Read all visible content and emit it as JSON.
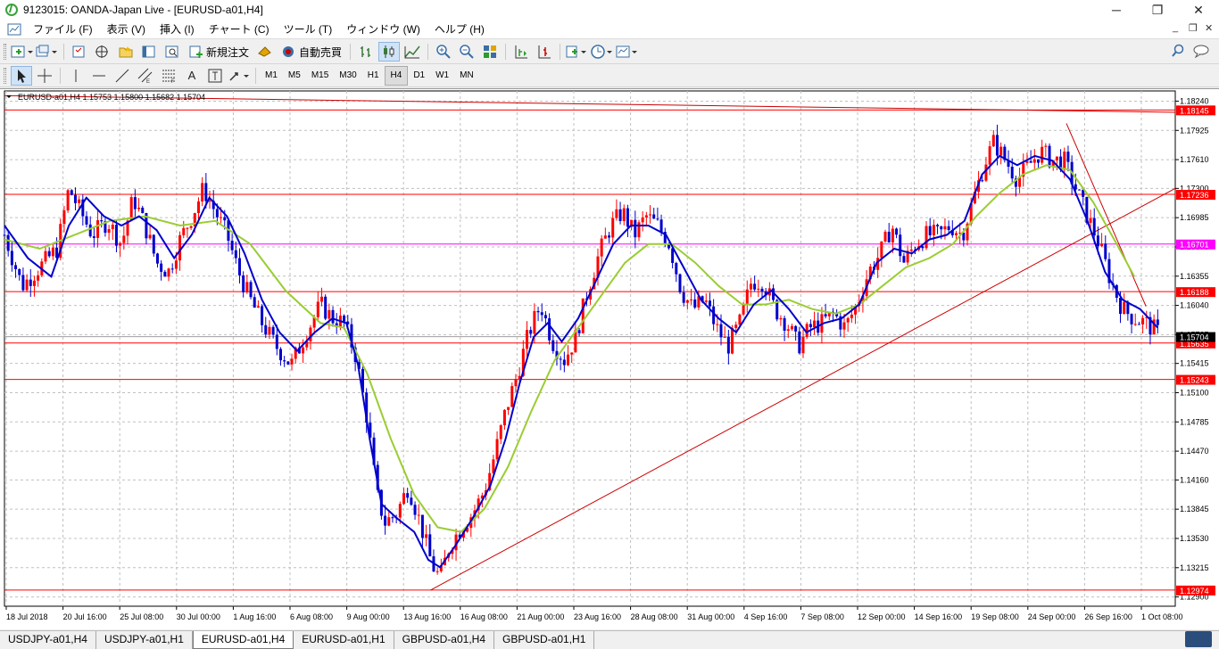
{
  "window": {
    "title": "9123015: OANDA-Japan Live - [EURUSD-a01,H4]",
    "controls": {
      "minimize": "─",
      "maximize": "❐",
      "close": "✕"
    }
  },
  "menu": {
    "items": [
      "ファイル (F)",
      "表示 (V)",
      "挿入 (I)",
      "チャート (C)",
      "ツール (T)",
      "ウィンドウ (W)",
      "ヘルプ (H)"
    ],
    "mdi_controls": {
      "minimize": "_",
      "restore": "❐",
      "close": "✕"
    }
  },
  "toolbar": {
    "new_order_label": "新規注文",
    "autotrade_label": "自動売買",
    "timeframes": [
      "M1",
      "M5",
      "M15",
      "M30",
      "H1",
      "H4",
      "D1",
      "W1",
      "MN"
    ],
    "active_timeframe": "H4",
    "text_tool_label": "A"
  },
  "chart_data": {
    "type": "candlestick",
    "header": "EURUSD-a01,H4  1.15753 1.15800 1.15682 1.15704",
    "ylim": [
      1.128,
      1.1835
    ],
    "price_ticks": [
      "1.18240",
      "1.17925",
      "1.17610",
      "1.17300",
      "1.16985",
      "1.16670",
      "1.16355",
      "1.16040",
      "1.15725",
      "1.15415",
      "1.15100",
      "1.14785",
      "1.14470",
      "1.14160",
      "1.13845",
      "1.13530",
      "1.13215",
      "1.12900"
    ],
    "time_labels": [
      "18 Jul 2018",
      "20 Jul 16:00",
      "25 Jul 08:00",
      "30 Jul 00:00",
      "1 Aug 16:00",
      "6 Aug 08:00",
      "9 Aug 00:00",
      "13 Aug 16:00",
      "16 Aug 08:00",
      "21 Aug 00:00",
      "23 Aug 16:00",
      "28 Aug 08:00",
      "31 Aug 00:00",
      "4 Sep 16:00",
      "7 Sep 08:00",
      "12 Sep 00:00",
      "14 Sep 16:00",
      "19 Sep 08:00",
      "24 Sep 00:00",
      "26 Sep 16:00",
      "1 Oct 08:00"
    ],
    "horizontal_levels": [
      {
        "label": "1.18145",
        "price": 1.18145,
        "color": "#ff0000"
      },
      {
        "label": "1.17236",
        "price": 1.17236,
        "color": "#ff0000"
      },
      {
        "label": "1.16701",
        "price": 1.16701,
        "color": "#ff00ff"
      },
      {
        "label": "1.16188",
        "price": 1.16188,
        "color": "#ff0000"
      },
      {
        "label": "1.15635",
        "price": 1.15635,
        "color": "#ff0000"
      },
      {
        "label": "1.15243",
        "price": 1.15243,
        "color": "#ff0000"
      },
      {
        "label": "1.12974",
        "price": 1.12974,
        "color": "#ff0000"
      }
    ],
    "current_price": {
      "label": "1.15704",
      "price": 1.15704
    },
    "trendlines": [
      {
        "from": [
          0.0,
          1.183
        ],
        "to": [
          1.0,
          1.1812
        ]
      },
      {
        "from": [
          0.364,
          1.12974
        ],
        "to": [
          1.0,
          1.173
        ]
      },
      {
        "from": [
          0.907,
          1.18
        ],
        "to": [
          0.975,
          1.1603
        ]
      }
    ],
    "close_path": [
      [
        0.0,
        1.168
      ],
      [
        0.015,
        1.1625
      ],
      [
        0.03,
        1.1645
      ],
      [
        0.045,
        1.1665
      ],
      [
        0.055,
        1.173
      ],
      [
        0.065,
        1.1705
      ],
      [
        0.075,
        1.168
      ],
      [
        0.088,
        1.1695
      ],
      [
        0.1,
        1.167
      ],
      [
        0.11,
        1.172
      ],
      [
        0.12,
        1.169
      ],
      [
        0.13,
        1.165
      ],
      [
        0.14,
        1.164
      ],
      [
        0.15,
        1.1675
      ],
      [
        0.16,
        1.17
      ],
      [
        0.17,
        1.173
      ],
      [
        0.18,
        1.1705
      ],
      [
        0.19,
        1.168
      ],
      [
        0.2,
        1.164
      ],
      [
        0.21,
        1.161
      ],
      [
        0.22,
        1.1585
      ],
      [
        0.232,
        1.156
      ],
      [
        0.245,
        1.154
      ],
      [
        0.258,
        1.1575
      ],
      [
        0.27,
        1.1605
      ],
      [
        0.28,
        1.159
      ],
      [
        0.29,
        1.1585
      ],
      [
        0.3,
        1.155
      ],
      [
        0.31,
        1.148
      ],
      [
        0.318,
        1.14
      ],
      [
        0.325,
        1.137
      ],
      [
        0.335,
        1.138
      ],
      [
        0.345,
        1.141
      ],
      [
        0.355,
        1.137
      ],
      [
        0.365,
        1.1325
      ],
      [
        0.372,
        1.131
      ],
      [
        0.38,
        1.1345
      ],
      [
        0.39,
        1.1365
      ],
      [
        0.4,
        1.138
      ],
      [
        0.41,
        1.1405
      ],
      [
        0.418,
        1.144
      ],
      [
        0.428,
        1.149
      ],
      [
        0.438,
        1.153
      ],
      [
        0.448,
        1.1575
      ],
      [
        0.458,
        1.1605
      ],
      [
        0.468,
        1.1565
      ],
      [
        0.478,
        1.1545
      ],
      [
        0.488,
        1.157
      ],
      [
        0.498,
        1.162
      ],
      [
        0.508,
        1.166
      ],
      [
        0.518,
        1.169
      ],
      [
        0.528,
        1.1705
      ],
      [
        0.538,
        1.168
      ],
      [
        0.548,
        1.17
      ],
      [
        0.558,
        1.169
      ],
      [
        0.568,
        1.167
      ],
      [
        0.578,
        1.162
      ],
      [
        0.588,
        1.16
      ],
      [
        0.598,
        1.161
      ],
      [
        0.608,
        1.158
      ],
      [
        0.618,
        1.156
      ],
      [
        0.628,
        1.1585
      ],
      [
        0.638,
        1.163
      ],
      [
        0.648,
        1.163
      ],
      [
        0.658,
        1.16
      ],
      [
        0.668,
        1.1585
      ],
      [
        0.678,
        1.156
      ],
      [
        0.688,
        1.158
      ],
      [
        0.698,
        1.1585
      ],
      [
        0.708,
        1.1595
      ],
      [
        0.718,
        1.158
      ],
      [
        0.728,
        1.1605
      ],
      [
        0.738,
        1.164
      ],
      [
        0.748,
        1.166
      ],
      [
        0.758,
        1.169
      ],
      [
        0.768,
        1.165
      ],
      [
        0.778,
        1.167
      ],
      [
        0.788,
        1.168
      ],
      [
        0.798,
        1.168
      ],
      [
        0.808,
        1.169
      ],
      [
        0.818,
        1.168
      ],
      [
        0.828,
        1.172
      ],
      [
        0.838,
        1.176
      ],
      [
        0.845,
        1.178
      ],
      [
        0.855,
        1.176
      ],
      [
        0.865,
        1.174
      ],
      [
        0.875,
        1.1755
      ],
      [
        0.885,
        1.177
      ],
      [
        0.895,
        1.176
      ],
      [
        0.905,
        1.176
      ],
      [
        0.915,
        1.173
      ],
      [
        0.925,
        1.17
      ],
      [
        0.935,
        1.167
      ],
      [
        0.945,
        1.163
      ],
      [
        0.955,
        1.16
      ],
      [
        0.965,
        1.159
      ],
      [
        0.975,
        1.1585
      ],
      [
        0.985,
        1.1575
      ]
    ],
    "ma_fast": [
      [
        0.0,
        1.169
      ],
      [
        0.02,
        1.1655
      ],
      [
        0.04,
        1.1635
      ],
      [
        0.055,
        1.169
      ],
      [
        0.07,
        1.172
      ],
      [
        0.085,
        1.17
      ],
      [
        0.1,
        1.169
      ],
      [
        0.115,
        1.17
      ],
      [
        0.13,
        1.1685
      ],
      [
        0.145,
        1.1655
      ],
      [
        0.16,
        1.168
      ],
      [
        0.175,
        1.172
      ],
      [
        0.19,
        1.17
      ],
      [
        0.205,
        1.166
      ],
      [
        0.22,
        1.161
      ],
      [
        0.235,
        1.1575
      ],
      [
        0.25,
        1.1555
      ],
      [
        0.265,
        1.1575
      ],
      [
        0.28,
        1.159
      ],
      [
        0.292,
        1.1585
      ],
      [
        0.302,
        1.154
      ],
      [
        0.312,
        1.146
      ],
      [
        0.322,
        1.139
      ],
      [
        0.335,
        1.1375
      ],
      [
        0.35,
        1.136
      ],
      [
        0.362,
        1.133
      ],
      [
        0.372,
        1.1322
      ],
      [
        0.385,
        1.1345
      ],
      [
        0.4,
        1.1375
      ],
      [
        0.415,
        1.141
      ],
      [
        0.428,
        1.146
      ],
      [
        0.44,
        1.152
      ],
      [
        0.452,
        1.157
      ],
      [
        0.464,
        1.1585
      ],
      [
        0.476,
        1.1565
      ],
      [
        0.49,
        1.159
      ],
      [
        0.505,
        1.163
      ],
      [
        0.52,
        1.167
      ],
      [
        0.535,
        1.169
      ],
      [
        0.55,
        1.169
      ],
      [
        0.565,
        1.168
      ],
      [
        0.58,
        1.1645
      ],
      [
        0.595,
        1.161
      ],
      [
        0.61,
        1.159
      ],
      [
        0.625,
        1.1575
      ],
      [
        0.64,
        1.1605
      ],
      [
        0.655,
        1.162
      ],
      [
        0.67,
        1.16
      ],
      [
        0.685,
        1.1575
      ],
      [
        0.7,
        1.1585
      ],
      [
        0.715,
        1.159
      ],
      [
        0.73,
        1.1605
      ],
      [
        0.745,
        1.165
      ],
      [
        0.76,
        1.1665
      ],
      [
        0.775,
        1.166
      ],
      [
        0.79,
        1.1675
      ],
      [
        0.805,
        1.168
      ],
      [
        0.82,
        1.1695
      ],
      [
        0.835,
        1.1745
      ],
      [
        0.85,
        1.1765
      ],
      [
        0.865,
        1.1755
      ],
      [
        0.88,
        1.1765
      ],
      [
        0.895,
        1.176
      ],
      [
        0.91,
        1.174
      ],
      [
        0.925,
        1.1695
      ],
      [
        0.94,
        1.164
      ],
      [
        0.955,
        1.161
      ],
      [
        0.97,
        1.16
      ],
      [
        0.985,
        1.158
      ]
    ],
    "ma_slow": [
      [
        0.0,
        1.1675
      ],
      [
        0.03,
        1.1665
      ],
      [
        0.06,
        1.168
      ],
      [
        0.09,
        1.1695
      ],
      [
        0.12,
        1.17
      ],
      [
        0.15,
        1.169
      ],
      [
        0.18,
        1.1695
      ],
      [
        0.21,
        1.167
      ],
      [
        0.24,
        1.162
      ],
      [
        0.27,
        1.1585
      ],
      [
        0.29,
        1.158
      ],
      [
        0.31,
        1.153
      ],
      [
        0.33,
        1.146
      ],
      [
        0.35,
        1.14
      ],
      [
        0.37,
        1.1365
      ],
      [
        0.39,
        1.136
      ],
      [
        0.41,
        1.1385
      ],
      [
        0.43,
        1.143
      ],
      [
        0.45,
        1.149
      ],
      [
        0.47,
        1.1545
      ],
      [
        0.49,
        1.158
      ],
      [
        0.51,
        1.1615
      ],
      [
        0.53,
        1.165
      ],
      [
        0.55,
        1.167
      ],
      [
        0.57,
        1.167
      ],
      [
        0.59,
        1.165
      ],
      [
        0.61,
        1.1625
      ],
      [
        0.63,
        1.1605
      ],
      [
        0.65,
        1.1605
      ],
      [
        0.67,
        1.161
      ],
      [
        0.69,
        1.16
      ],
      [
        0.71,
        1.1595
      ],
      [
        0.73,
        1.1605
      ],
      [
        0.75,
        1.1625
      ],
      [
        0.77,
        1.1645
      ],
      [
        0.79,
        1.1655
      ],
      [
        0.81,
        1.167
      ],
      [
        0.83,
        1.17
      ],
      [
        0.85,
        1.1725
      ],
      [
        0.87,
        1.1745
      ],
      [
        0.89,
        1.1755
      ],
      [
        0.91,
        1.175
      ],
      [
        0.93,
        1.1715
      ],
      [
        0.95,
        1.167
      ],
      [
        0.965,
        1.1635
      ]
    ],
    "colors": {
      "bull": "#ff0000",
      "bear": "#0000cc",
      "ma_fast": "#0000cc",
      "ma_slow": "#9acd32",
      "grid": "#c0c0c0",
      "axis_text": "#000000"
    }
  },
  "tabs": [
    "USDJPY-a01,H4",
    "USDJPY-a01,H1",
    "EURUSD-a01,H4",
    "EURUSD-a01,H1",
    "GBPUSD-a01,H4",
    "GBPUSD-a01,H1"
  ],
  "active_tab": "EURUSD-a01,H4"
}
